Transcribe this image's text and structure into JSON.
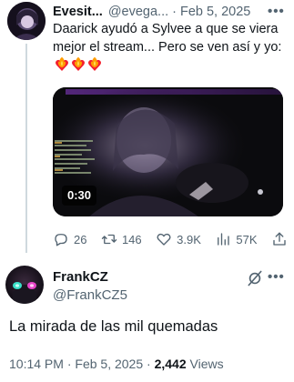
{
  "parent_tweet": {
    "display_name": "Evesit...",
    "handle": "@evega...",
    "separator": "·",
    "date": "Feb 5, 2025",
    "text": "Daarick ayudó a Sylvee a que se viera mejor el stream... Pero se ven así y yo:",
    "emoji_icons": [
      "fire-heart-icon",
      "fire-heart-icon",
      "fire-heart-icon"
    ],
    "video": {
      "duration": "0:30"
    },
    "actions": {
      "replies": "26",
      "reposts": "146",
      "likes": "3.9K",
      "views": "57K"
    }
  },
  "reply": {
    "display_name": "FrankCZ",
    "handle": "@FrankCZ5",
    "text": "La mirada de las mil quemadas",
    "time": "10:14 PM",
    "separator": "·",
    "date": "Feb 5, 2025",
    "views_count": "2,442",
    "views_label": "Views"
  },
  "colors": {
    "text_primary": "#0f1419",
    "text_secondary": "#536471",
    "thread_line": "#cfd9de",
    "fire_heart": "#f4212e"
  }
}
